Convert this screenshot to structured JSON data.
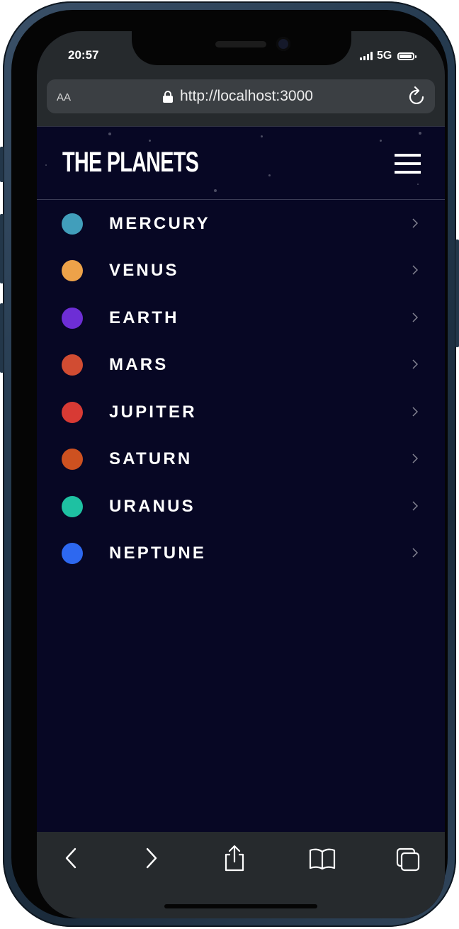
{
  "status_bar": {
    "time": "20:57",
    "network": "5G"
  },
  "browser": {
    "text_size_label": "AA",
    "url": "http://localhost:3000"
  },
  "site": {
    "title": "THE PLANETS"
  },
  "planets": [
    {
      "name": "MERCURY",
      "color": "#419EBB"
    },
    {
      "name": "VENUS",
      "color": "#EDA249"
    },
    {
      "name": "EARTH",
      "color": "#6D2ED5"
    },
    {
      "name": "MARS",
      "color": "#D14C32"
    },
    {
      "name": "JUPITER",
      "color": "#D83A34"
    },
    {
      "name": "SATURN",
      "color": "#CD5120"
    },
    {
      "name": "URANUS",
      "color": "#1EC1A2"
    },
    {
      "name": "NEPTUNE",
      "color": "#2D68F0"
    }
  ],
  "colors": {
    "page_background": "#070724",
    "browser_chrome": "#262a2d",
    "url_field": "#3b3f43",
    "text": "#ffffff",
    "chevron": "#838391"
  },
  "icons": {
    "lock": "lock-icon",
    "reload": "reload-icon",
    "menu": "hamburger-menu-icon",
    "chevron": "chevron-right-icon",
    "back": "back-icon",
    "forward": "forward-icon",
    "share": "share-icon",
    "bookmarks": "bookmarks-icon",
    "tabs": "tabs-icon"
  }
}
